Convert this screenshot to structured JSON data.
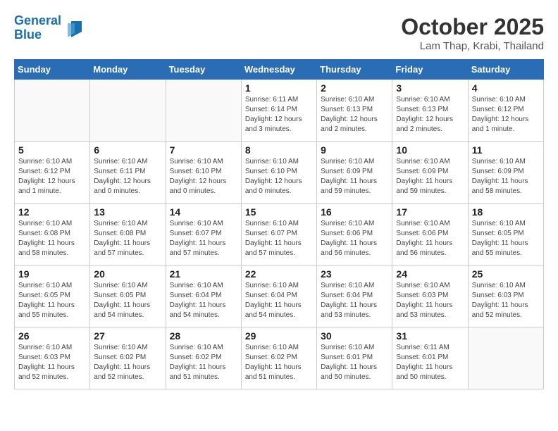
{
  "header": {
    "logo_line1": "General",
    "logo_line2": "Blue",
    "month": "October 2025",
    "location": "Lam Thap, Krabi, Thailand"
  },
  "weekdays": [
    "Sunday",
    "Monday",
    "Tuesday",
    "Wednesday",
    "Thursday",
    "Friday",
    "Saturday"
  ],
  "weeks": [
    [
      {
        "num": "",
        "info": ""
      },
      {
        "num": "",
        "info": ""
      },
      {
        "num": "",
        "info": ""
      },
      {
        "num": "1",
        "info": "Sunrise: 6:11 AM\nSunset: 6:14 PM\nDaylight: 12 hours and 3 minutes."
      },
      {
        "num": "2",
        "info": "Sunrise: 6:10 AM\nSunset: 6:13 PM\nDaylight: 12 hours and 2 minutes."
      },
      {
        "num": "3",
        "info": "Sunrise: 6:10 AM\nSunset: 6:13 PM\nDaylight: 12 hours and 2 minutes."
      },
      {
        "num": "4",
        "info": "Sunrise: 6:10 AM\nSunset: 6:12 PM\nDaylight: 12 hours and 1 minute."
      }
    ],
    [
      {
        "num": "5",
        "info": "Sunrise: 6:10 AM\nSunset: 6:12 PM\nDaylight: 12 hours and 1 minute."
      },
      {
        "num": "6",
        "info": "Sunrise: 6:10 AM\nSunset: 6:11 PM\nDaylight: 12 hours and 0 minutes."
      },
      {
        "num": "7",
        "info": "Sunrise: 6:10 AM\nSunset: 6:10 PM\nDaylight: 12 hours and 0 minutes."
      },
      {
        "num": "8",
        "info": "Sunrise: 6:10 AM\nSunset: 6:10 PM\nDaylight: 12 hours and 0 minutes."
      },
      {
        "num": "9",
        "info": "Sunrise: 6:10 AM\nSunset: 6:09 PM\nDaylight: 11 hours and 59 minutes."
      },
      {
        "num": "10",
        "info": "Sunrise: 6:10 AM\nSunset: 6:09 PM\nDaylight: 11 hours and 59 minutes."
      },
      {
        "num": "11",
        "info": "Sunrise: 6:10 AM\nSunset: 6:09 PM\nDaylight: 11 hours and 58 minutes."
      }
    ],
    [
      {
        "num": "12",
        "info": "Sunrise: 6:10 AM\nSunset: 6:08 PM\nDaylight: 11 hours and 58 minutes."
      },
      {
        "num": "13",
        "info": "Sunrise: 6:10 AM\nSunset: 6:08 PM\nDaylight: 11 hours and 57 minutes."
      },
      {
        "num": "14",
        "info": "Sunrise: 6:10 AM\nSunset: 6:07 PM\nDaylight: 11 hours and 57 minutes."
      },
      {
        "num": "15",
        "info": "Sunrise: 6:10 AM\nSunset: 6:07 PM\nDaylight: 11 hours and 57 minutes."
      },
      {
        "num": "16",
        "info": "Sunrise: 6:10 AM\nSunset: 6:06 PM\nDaylight: 11 hours and 56 minutes."
      },
      {
        "num": "17",
        "info": "Sunrise: 6:10 AM\nSunset: 6:06 PM\nDaylight: 11 hours and 56 minutes."
      },
      {
        "num": "18",
        "info": "Sunrise: 6:10 AM\nSunset: 6:05 PM\nDaylight: 11 hours and 55 minutes."
      }
    ],
    [
      {
        "num": "19",
        "info": "Sunrise: 6:10 AM\nSunset: 6:05 PM\nDaylight: 11 hours and 55 minutes."
      },
      {
        "num": "20",
        "info": "Sunrise: 6:10 AM\nSunset: 6:05 PM\nDaylight: 11 hours and 54 minutes."
      },
      {
        "num": "21",
        "info": "Sunrise: 6:10 AM\nSunset: 6:04 PM\nDaylight: 11 hours and 54 minutes."
      },
      {
        "num": "22",
        "info": "Sunrise: 6:10 AM\nSunset: 6:04 PM\nDaylight: 11 hours and 54 minutes."
      },
      {
        "num": "23",
        "info": "Sunrise: 6:10 AM\nSunset: 6:04 PM\nDaylight: 11 hours and 53 minutes."
      },
      {
        "num": "24",
        "info": "Sunrise: 6:10 AM\nSunset: 6:03 PM\nDaylight: 11 hours and 53 minutes."
      },
      {
        "num": "25",
        "info": "Sunrise: 6:10 AM\nSunset: 6:03 PM\nDaylight: 11 hours and 52 minutes."
      }
    ],
    [
      {
        "num": "26",
        "info": "Sunrise: 6:10 AM\nSunset: 6:03 PM\nDaylight: 11 hours and 52 minutes."
      },
      {
        "num": "27",
        "info": "Sunrise: 6:10 AM\nSunset: 6:02 PM\nDaylight: 11 hours and 52 minutes."
      },
      {
        "num": "28",
        "info": "Sunrise: 6:10 AM\nSunset: 6:02 PM\nDaylight: 11 hours and 51 minutes."
      },
      {
        "num": "29",
        "info": "Sunrise: 6:10 AM\nSunset: 6:02 PM\nDaylight: 11 hours and 51 minutes."
      },
      {
        "num": "30",
        "info": "Sunrise: 6:10 AM\nSunset: 6:01 PM\nDaylight: 11 hours and 50 minutes."
      },
      {
        "num": "31",
        "info": "Sunrise: 6:11 AM\nSunset: 6:01 PM\nDaylight: 11 hours and 50 minutes."
      },
      {
        "num": "",
        "info": ""
      }
    ]
  ]
}
